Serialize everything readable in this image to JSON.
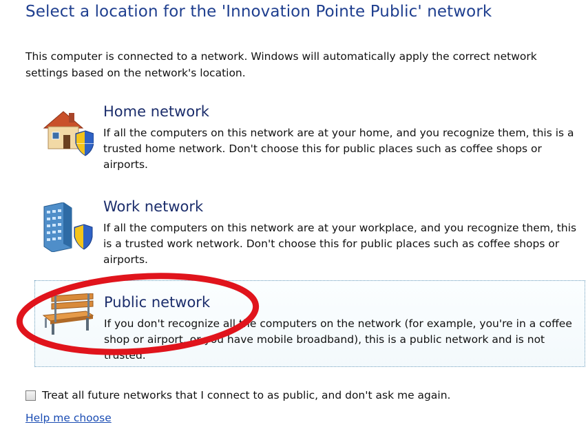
{
  "dialog": {
    "title": "Select a location for the 'Innovation Pointe Public' network",
    "intro": "This computer is connected to a network. Windows will automatically apply the correct network settings based on the network's location."
  },
  "options": [
    {
      "title": "Home network",
      "description": "If all the computers on this network are at your home, and you recognize them, this is a trusted home network.  Don't choose this for public places such as coffee shops or airports.",
      "icon": "house-shield-icon"
    },
    {
      "title": "Work network",
      "description": "If all the computers on this network are at your workplace, and you recognize them, this is a trusted work network.  Don't choose this for public places such as coffee shops or airports.",
      "icon": "office-building-shield-icon"
    },
    {
      "title": "Public network",
      "description": "If you don't recognize all the computers on the network (for example, you're in a coffee shop or airport, or you have mobile broadband), this is a public network and is not trusted.",
      "icon": "park-bench-icon"
    }
  ],
  "checkbox": {
    "label": "Treat all future networks that I connect to as public, and don't ask me again.",
    "checked": false
  },
  "help_link": "Help me choose",
  "colors": {
    "title_blue": "#1f3f8f",
    "link_blue": "#1a4cb3",
    "annotation_red": "#e0141c"
  }
}
